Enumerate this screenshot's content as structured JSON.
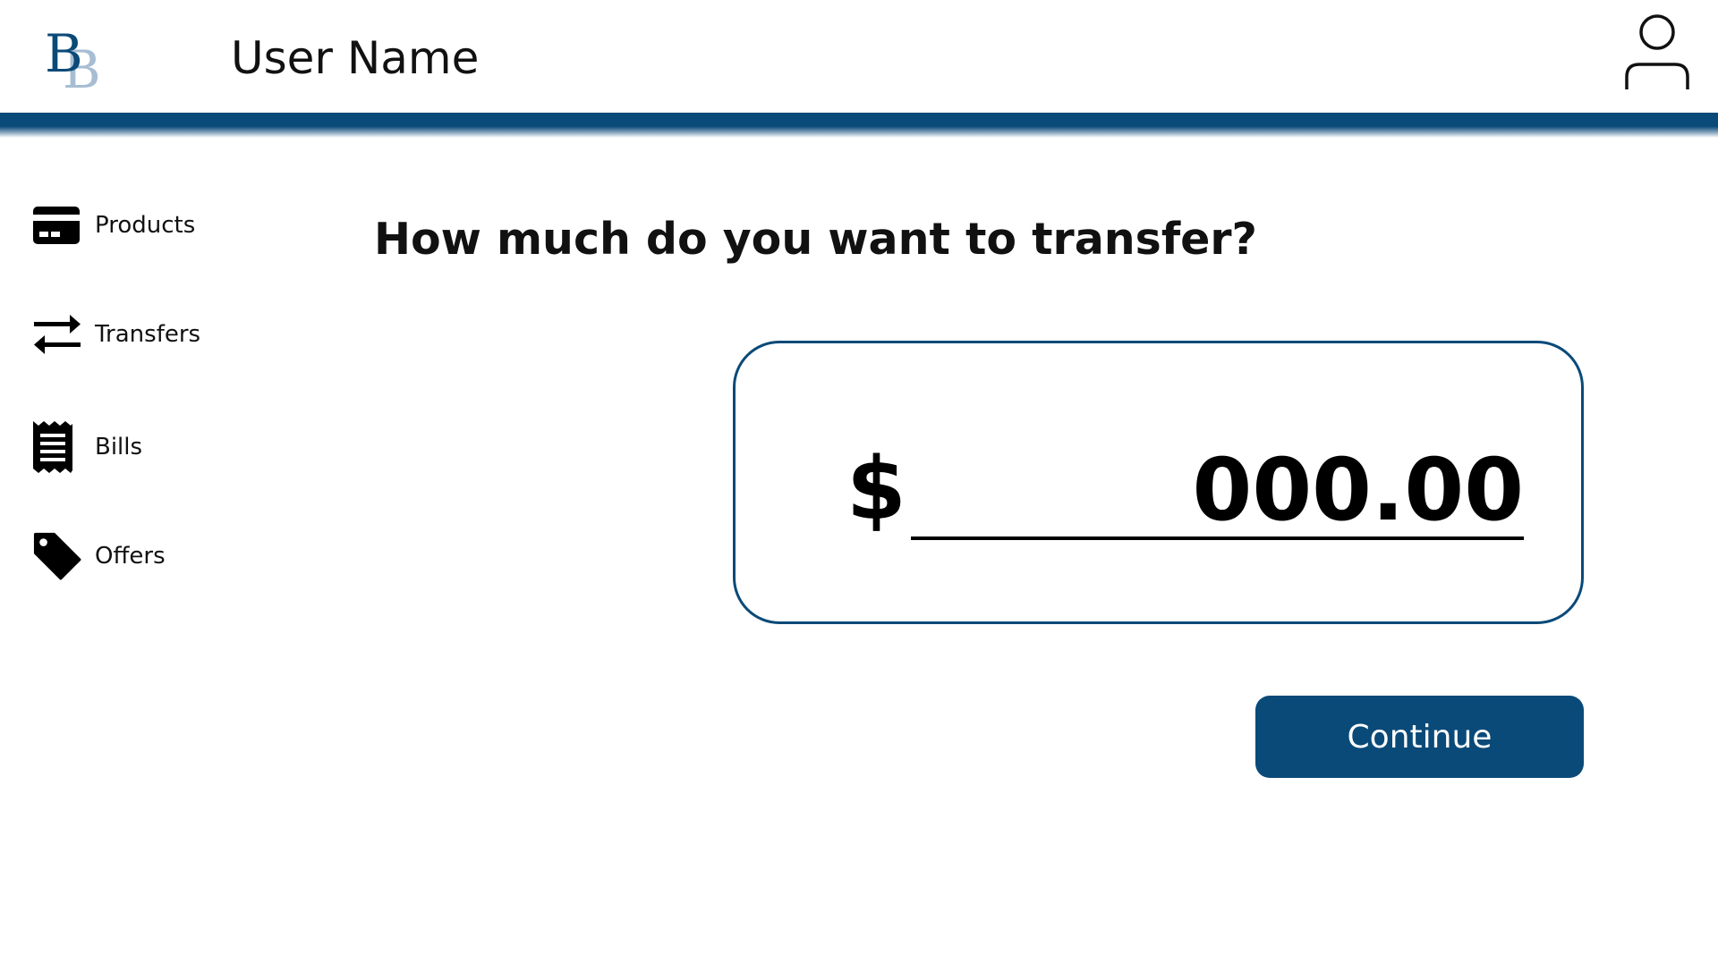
{
  "header": {
    "logo_primary": "B",
    "logo_secondary": "B",
    "user_name": "User Name",
    "profile_icon": "user-icon"
  },
  "sidebar": {
    "items": [
      {
        "label": "Products",
        "icon": "credit-card-icon"
      },
      {
        "label": "Transfers",
        "icon": "transfer-arrows-icon"
      },
      {
        "label": "Bills",
        "icon": "receipt-icon"
      },
      {
        "label": "Offers",
        "icon": "tag-icon"
      }
    ]
  },
  "main": {
    "question": "How much do you want to transfer?",
    "currency_symbol": "$",
    "amount_value": "000.00",
    "continue_label": "Continue"
  },
  "colors": {
    "brand_primary": "#0a4a78",
    "brand_light": "#a7bdd3",
    "background": "#ffffff"
  }
}
